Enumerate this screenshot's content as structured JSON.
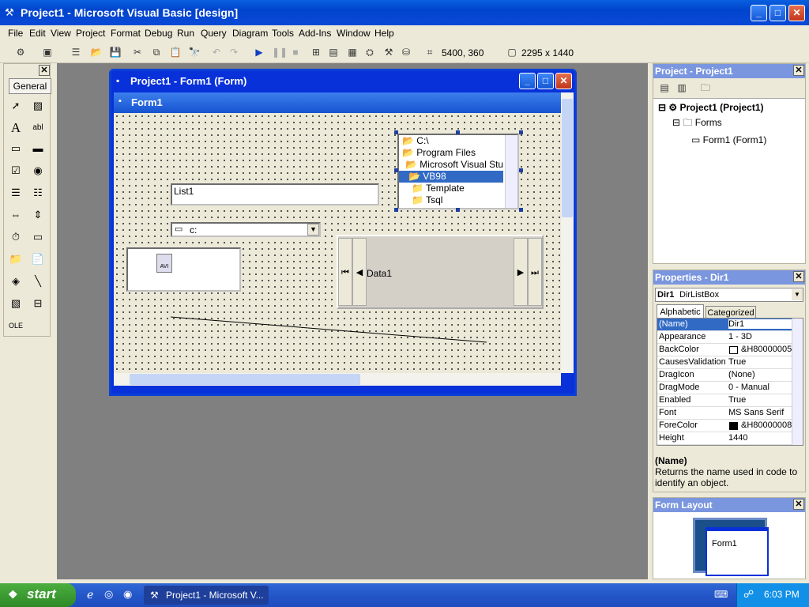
{
  "window": {
    "title": "Project1 - Microsoft Visual Basic [design]"
  },
  "menu": [
    "File",
    "Edit",
    "View",
    "Project",
    "Format",
    "Debug",
    "Run",
    "Query",
    "Diagram",
    "Tools",
    "Add-Ins",
    "Window",
    "Help"
  ],
  "toolbar": {
    "position": "5400, 360",
    "size": "2295 x 1440"
  },
  "toolbox": {
    "tab_label": "General"
  },
  "form_window": {
    "title": "Project1 - Form1 (Form)",
    "form_caption": "Form1",
    "listbox_text": "List1",
    "drive_text": "c:",
    "dir_items": [
      "C:\\",
      "Program Files",
      "Microsoft Visual Studio",
      "VB98",
      "Template",
      "Tsql"
    ],
    "data_caption": "Data1",
    "anim_label": "AVI"
  },
  "project_pane": {
    "title": "Project - Project1",
    "root": "Project1 (Project1)",
    "folder": "Forms",
    "item": "Form1 (Form1)"
  },
  "properties_pane": {
    "title": "Properties - Dir1",
    "object_name": "Dir1",
    "object_type": "DirListBox",
    "tab_alphabetic": "Alphabetic",
    "tab_categorized": "Categorized",
    "rows": [
      {
        "name": "(Name)",
        "value": "Dir1"
      },
      {
        "name": "Appearance",
        "value": "1 - 3D"
      },
      {
        "name": "BackColor",
        "value": "&H80000005"
      },
      {
        "name": "CausesValidation",
        "value": "True"
      },
      {
        "name": "DragIcon",
        "value": "(None)"
      },
      {
        "name": "DragMode",
        "value": "0 - Manual"
      },
      {
        "name": "Enabled",
        "value": "True"
      },
      {
        "name": "Font",
        "value": "MS Sans Serif"
      },
      {
        "name": "ForeColor",
        "value": "&H80000008"
      },
      {
        "name": "Height",
        "value": "1440"
      }
    ],
    "desc_title": "(Name)",
    "desc_text": "Returns the name used in code to identify an object."
  },
  "layout_pane": {
    "title": "Form Layout",
    "form_label": "Form1"
  },
  "taskbar": {
    "start": "start",
    "task": "Project1 - Microsoft V...",
    "time": "6:03 PM"
  }
}
